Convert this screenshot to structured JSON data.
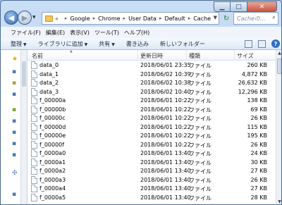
{
  "address": {
    "overflow": "«",
    "crumbs": [
      "Google",
      "Chrome",
      "User Data",
      "Default",
      "Cache"
    ]
  },
  "search": {
    "placeholder": "Cacheの..."
  },
  "menu": [
    "ファイル(F)",
    "編集(E)",
    "表示(V)",
    "ツール(T)",
    "ヘルプ(H)"
  ],
  "toolbar": {
    "organize": "整理",
    "library": "ライブラリに追加",
    "share": "共有",
    "burn": "書き込み",
    "new_folder": "新しいフォルダー"
  },
  "columns": {
    "name": "名前",
    "date": "更新日時",
    "type": "種類",
    "size": "サイズ"
  },
  "files": [
    {
      "name": "data_0",
      "date": "2018/06/01 23:35",
      "type": "ファイル",
      "size": "260 KB"
    },
    {
      "name": "data_1",
      "date": "2018/06/02 10:39",
      "type": "ファイル",
      "size": "4,872 KB"
    },
    {
      "name": "data_2",
      "date": "2018/06/02 10:38",
      "type": "ファイル",
      "size": "26,632 KB"
    },
    {
      "name": "data_3",
      "date": "2018/06/02 10:40",
      "type": "ファイル",
      "size": "12,296 KB"
    },
    {
      "name": "f_00000a",
      "date": "2018/06/01 10:22",
      "type": "ファイル",
      "size": "138 KB"
    },
    {
      "name": "f_00000b",
      "date": "2018/06/01 10:22",
      "type": "ファイル",
      "size": "69 KB"
    },
    {
      "name": "f_00000c",
      "date": "2018/06/01 10:22",
      "type": "ファイル",
      "size": "26 KB"
    },
    {
      "name": "f_00000d",
      "date": "2018/06/01 10:22",
      "type": "ファイル",
      "size": "115 KB"
    },
    {
      "name": "f_00000e",
      "date": "2018/06/01 10:22",
      "type": "ファイル",
      "size": "195 KB"
    },
    {
      "name": "f_00000f",
      "date": "2018/06/01 10:22",
      "type": "ファイル",
      "size": "26 KB"
    },
    {
      "name": "f_0000a0",
      "date": "2018/06/01 13:40",
      "type": "ファイル",
      "size": "24 KB"
    },
    {
      "name": "f_0000a1",
      "date": "2018/06/01 13:40",
      "type": "ファイル",
      "size": "30 KB"
    },
    {
      "name": "f_0000a2",
      "date": "2018/06/01 13:40",
      "type": "ファイル",
      "size": "27 KB"
    },
    {
      "name": "f_0000a3",
      "date": "2018/06/01 13:40",
      "type": "ファイル",
      "size": "26 KB"
    },
    {
      "name": "f_0000a4",
      "date": "2018/06/01 13:40",
      "type": "ファイル",
      "size": "27 KB"
    },
    {
      "name": "f_0000a5",
      "date": "2018/06/01 13:40",
      "type": "ファイル",
      "size": "28 KB"
    }
  ]
}
